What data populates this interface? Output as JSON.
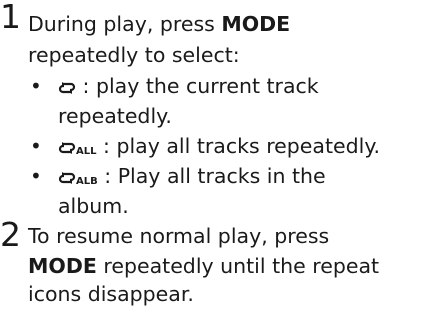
{
  "steps": [
    {
      "number": "1",
      "line1_pre": "During play, press ",
      "line1_bold": "MODE",
      "line2": "repeatedly to select:",
      "options": [
        {
          "icon": "repeat-one-icon",
          "icon_label": "",
          "line1": ": play the current track",
          "line2": "repeatedly."
        },
        {
          "icon": "repeat-all-icon",
          "icon_label": "ALL",
          "line1": ": play all tracks repeatedly.",
          "line2": ""
        },
        {
          "icon": "repeat-album-icon",
          "icon_label": "ALB",
          "line1": ": Play all tracks in the",
          "line2": "album."
        }
      ]
    },
    {
      "number": "2",
      "line1": "To resume normal play, press",
      "line2_bold": "MODE",
      "line2_post": " repeatedly until the repeat",
      "line3": "icons disappear."
    }
  ]
}
